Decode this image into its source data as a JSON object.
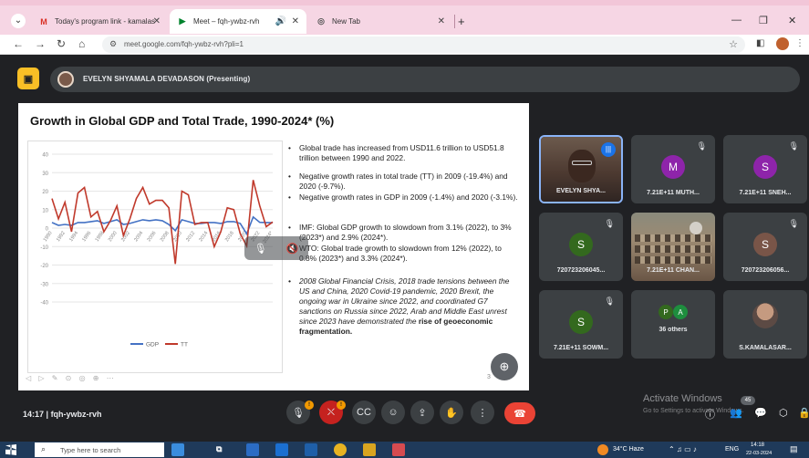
{
  "browser": {
    "tabs": [
      {
        "label": "Today's program link - kamalas",
        "favicon": "gmail-icon",
        "active": false
      },
      {
        "label": "Meet – fqh-ywbz-rvh",
        "favicon": "meet-icon",
        "active": true
      },
      {
        "label": "New Tab",
        "favicon": "chrome-icon",
        "active": false
      }
    ],
    "url": "meet.google.com/fqh-ywbz-rvh?pli=1"
  },
  "meet": {
    "presenter_label": "EVELYN SHYAMALA DEVADASON (Presenting)",
    "time": "14:17",
    "meeting_code": "fqh-ywbz-rvh",
    "participants_count": "45",
    "activate_title": "Activate Windows",
    "activate_sub": "Go to Settings to activate Windows.",
    "tiles": [
      {
        "name": "EVELYN SHYA...",
        "type": "photo-presenter"
      },
      {
        "name": "7.21E+11 MUTH...",
        "initial": "M",
        "color": "#8e24aa"
      },
      {
        "name": "7.21E+11 SNEH...",
        "initial": "S",
        "color": "#8e24aa"
      },
      {
        "name": "720723206045...",
        "initial": "S",
        "color": "#33691e"
      },
      {
        "name": "7.21E+11 CHAN...",
        "type": "photo-class"
      },
      {
        "name": "720723206056...",
        "initial": "S",
        "color": "#795548"
      },
      {
        "name": "7.21E+11 SOWM...",
        "initial": "S",
        "color": "#33691e"
      },
      {
        "name": "36 others",
        "type": "others",
        "initials": [
          "P",
          "A"
        ],
        "colors": [
          "#33691e",
          "#1e8e3e"
        ]
      },
      {
        "name": "S.KAMALASAR...",
        "type": "photo-sk"
      }
    ],
    "badges": {
      "mic": "!",
      "camera": "!"
    }
  },
  "slide": {
    "title": "Growth in Global GDP and Total Trade, 1990-2024* (%)",
    "page": "3",
    "bullets": [
      {
        "text": "Global trade has increased from USD11.6 trillion to USD51.8 trillion between 1990 and 2022.",
        "style": "normal"
      },
      {
        "text": "Negative growth rates in total trade (TT) in 2009 (-19.4%) and 2020 (-9.7%).",
        "style": "small-gap"
      },
      {
        "text": "Negative growth rates in GDP in 2009 (-1.4%) and 2020 (-3.1%).",
        "style": "normal"
      },
      {
        "text": "IMF: Global GDP growth to slowdown from 3.1% (2022), to 3% (2023*) and 2.9% (2024*).",
        "style": "small-gap"
      },
      {
        "text": "WTO: Global trade growth to slowdown from 12% (2022), to 0.8% (2023*) and 3.3% (2024*).",
        "style": "normal"
      },
      {
        "text": "2008 Global Financial Crisis, 2018 trade tensions between the US and China, 2020 Covid-19 pandemic, 2020 Brexit, the ongoing war in Ukraine since 2022, and coordinated G7 sanctions on Russia since 2022, Arab and Middle East unrest since 2023 have demonstrated the ",
        "bold": "rise of geoeconomic fragmentation",
        "tail": ".",
        "style": "italic"
      }
    ]
  },
  "chart_data": {
    "type": "line",
    "title": "",
    "xlabel": "",
    "ylabel": "",
    "ylim": [
      -40,
      40
    ],
    "yticks": [
      40,
      30,
      20,
      10,
      0,
      -10,
      -20,
      -30,
      -40
    ],
    "x": [
      "1990",
      "1991",
      "1992",
      "1993",
      "1994",
      "1995",
      "1996",
      "1997",
      "1998",
      "1999",
      "2000",
      "2001",
      "2002",
      "2003",
      "2004",
      "2005",
      "2006",
      "2007",
      "2008",
      "2009",
      "2010",
      "2011",
      "2012",
      "2013",
      "2014",
      "2015",
      "2016",
      "2017",
      "2018",
      "2019",
      "2020",
      "2021",
      "2022",
      "2023*",
      "2024*"
    ],
    "xtick_labels": [
      "1990",
      "1992",
      "1994",
      "1996",
      "1998",
      "2000",
      "2002",
      "2004",
      "2006",
      "2008",
      "2010",
      "2012",
      "2014",
      "2016",
      "2018",
      "2020",
      "2022",
      "2024*"
    ],
    "series": [
      {
        "name": "GDP",
        "color": "#4472c4",
        "values": [
          3,
          1.5,
          2,
          1.5,
          3,
          3,
          3.5,
          4,
          2.5,
          3.5,
          4.5,
          2,
          2.5,
          3.5,
          4.5,
          4,
          4.5,
          4,
          2,
          -1.4,
          4.5,
          3.5,
          2.5,
          2.5,
          3,
          3,
          2.5,
          3.5,
          3.5,
          2.5,
          -3.1,
          6,
          3.1,
          3,
          2.9
        ]
      },
      {
        "name": "TT",
        "color": "#c0392b",
        "values": [
          16,
          5,
          14,
          -2,
          19,
          22,
          6,
          9,
          -2,
          4,
          12,
          -4,
          5,
          16,
          22,
          13,
          15,
          15,
          11,
          -19.4,
          20,
          18,
          2,
          3,
          3,
          -10,
          -2,
          11,
          10,
          -3,
          -9.7,
          26,
          12,
          0.8,
          3.3
        ]
      }
    ]
  },
  "taskbar": {
    "search_placeholder": "Type here to search",
    "weather": "34°C  Haze",
    "lang": "ENG",
    "time": "14:18",
    "date": "22-03-2024"
  }
}
